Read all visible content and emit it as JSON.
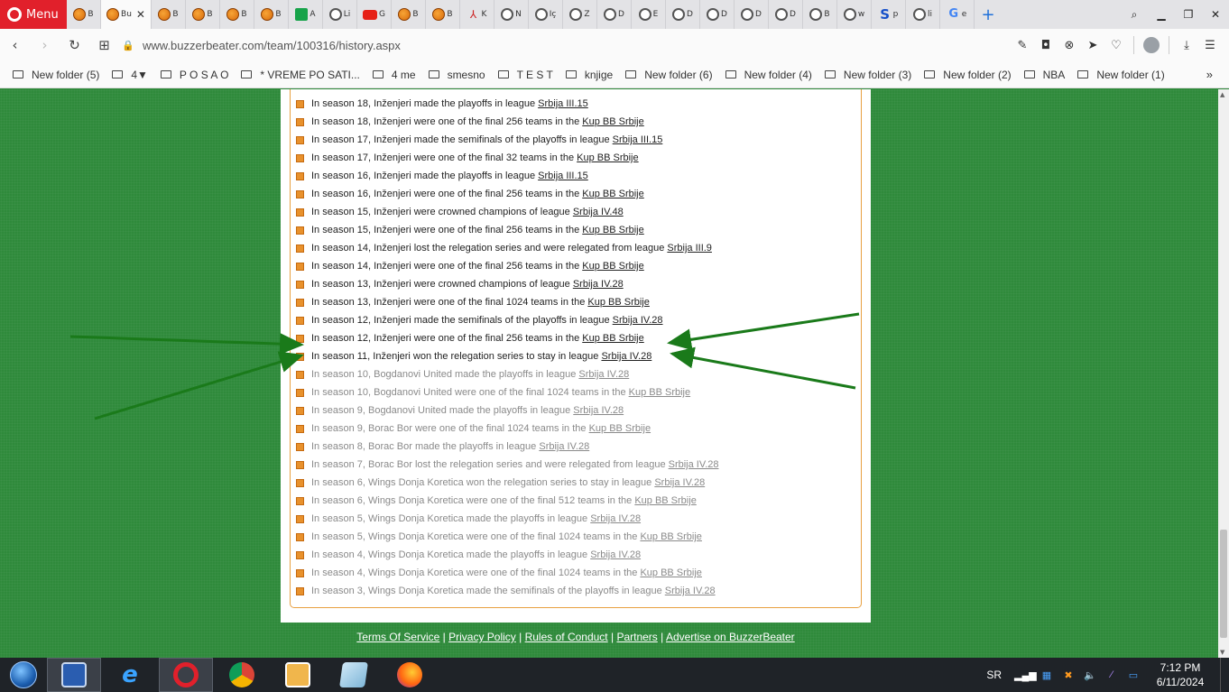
{
  "browser": {
    "menu_label": "Menu",
    "tabs": [
      {
        "label": "B",
        "icon": "ball"
      },
      {
        "label": "Bu",
        "icon": "ball",
        "active": true
      },
      {
        "label": "B",
        "icon": "ball"
      },
      {
        "label": "B",
        "icon": "ball"
      },
      {
        "label": "B",
        "icon": "ball"
      },
      {
        "label": "B",
        "icon": "ball"
      },
      {
        "label": "A",
        "icon": "green"
      },
      {
        "label": "Li",
        "icon": "gray"
      },
      {
        "label": "G",
        "icon": "yt"
      },
      {
        "label": "B",
        "icon": "ball"
      },
      {
        "label": "B",
        "icon": "ball"
      },
      {
        "label": "K",
        "icon": "red"
      },
      {
        "label": "N",
        "icon": "gray"
      },
      {
        "label": "Iç",
        "icon": "gray"
      },
      {
        "label": "Z",
        "icon": "gray"
      },
      {
        "label": "D",
        "icon": "gray"
      },
      {
        "label": "E",
        "icon": "gray"
      },
      {
        "label": "D",
        "icon": "gray"
      },
      {
        "label": "D",
        "icon": "gray"
      },
      {
        "label": "D",
        "icon": "gray"
      },
      {
        "label": "D",
        "icon": "gray"
      },
      {
        "label": "B",
        "icon": "gray"
      },
      {
        "label": "w",
        "icon": "gray"
      },
      {
        "label": "p",
        "icon": "s"
      },
      {
        "label": "li",
        "icon": "gray"
      },
      {
        "label": "e",
        "icon": "g"
      }
    ],
    "url": "www.buzzerbeater.com/team/100316/history.aspx",
    "bookmarks": [
      "New folder (5)",
      "4▼",
      "P O S A O",
      "* VREME PO SATI...",
      "4 me",
      "smesno",
      "T E S T",
      "knjige",
      "New folder (6)",
      "New folder (4)",
      "New folder (3)",
      "New folder (2)",
      "NBA",
      "New folder (1)"
    ]
  },
  "history": {
    "entries": [
      {
        "pre": "In season 18, Inženjeri made the playoffs in league ",
        "link": "Srbija III.15",
        "current": true
      },
      {
        "pre": "In season 18, Inženjeri were one of the final 256 teams in the ",
        "link": "Kup BB Srbije",
        "current": true
      },
      {
        "pre": "In season 17, Inženjeri made the semifinals of the playoffs in league ",
        "link": "Srbija III.15",
        "current": true
      },
      {
        "pre": "In season 17, Inženjeri were one of the final 32 teams in the ",
        "link": "Kup BB Srbije",
        "current": true
      },
      {
        "pre": "In season 16, Inženjeri made the playoffs in league ",
        "link": "Srbija III.15",
        "current": true
      },
      {
        "pre": "In season 16, Inženjeri were one of the final 256 teams in the ",
        "link": "Kup BB Srbije",
        "current": true
      },
      {
        "pre": "In season 15, Inženjeri were crowned champions of league ",
        "link": "Srbija IV.48",
        "current": true
      },
      {
        "pre": "In season 15, Inženjeri were one of the final 256 teams in the ",
        "link": "Kup BB Srbije",
        "current": true
      },
      {
        "pre": "In season 14, Inženjeri lost the relegation series and were relegated from league ",
        "link": "Srbija III.9",
        "current": true
      },
      {
        "pre": "In season 14, Inženjeri were one of the final 256 teams in the ",
        "link": "Kup BB Srbije",
        "current": true
      },
      {
        "pre": "In season 13, Inženjeri were crowned champions of league ",
        "link": "Srbija IV.28",
        "current": true
      },
      {
        "pre": "In season 13, Inženjeri were one of the final 1024 teams in the ",
        "link": "Kup BB Srbije",
        "current": true
      },
      {
        "pre": "In season 12, Inženjeri made the semifinals of the playoffs in league ",
        "link": "Srbija IV.28",
        "current": true
      },
      {
        "pre": "In season 12, Inženjeri were one of the final 256 teams in the ",
        "link": "Kup BB Srbije",
        "current": true
      },
      {
        "pre": "In season 11, Inženjeri won the relegation series to stay in league ",
        "link": "Srbija IV.28",
        "current": true
      },
      {
        "pre": "In season 10, Bogdanovi United made the playoffs in league ",
        "link": "Srbija IV.28",
        "current": false
      },
      {
        "pre": "In season 10, Bogdanovi United were one of the final 1024 teams in the ",
        "link": "Kup BB Srbije",
        "current": false
      },
      {
        "pre": "In season 9, Bogdanovi United made the playoffs in league ",
        "link": "Srbija IV.28",
        "current": false
      },
      {
        "pre": "In season 9, Borac Bor were one of the final 1024 teams in the ",
        "link": "Kup BB Srbije",
        "current": false
      },
      {
        "pre": "In season 8, Borac Bor made the playoffs in league ",
        "link": "Srbija IV.28",
        "current": false
      },
      {
        "pre": "In season 7, Borac Bor lost the relegation series and were relegated from league ",
        "link": "Srbija IV.28",
        "current": false
      },
      {
        "pre": "In season 6, Wings Donja Koretica won the relegation series to stay in league ",
        "link": "Srbija IV.28",
        "current": false
      },
      {
        "pre": "In season 6, Wings Donja Koretica were one of the final 512 teams in the ",
        "link": "Kup BB Srbije",
        "current": false
      },
      {
        "pre": "In season 5, Wings Donja Koretica made the playoffs in league ",
        "link": "Srbija IV.28",
        "current": false
      },
      {
        "pre": "In season 5, Wings Donja Koretica were one of the final 1024 teams in the ",
        "link": "Kup BB Srbije",
        "current": false
      },
      {
        "pre": "In season 4, Wings Donja Koretica made the playoffs in league ",
        "link": "Srbija IV.28",
        "current": false
      },
      {
        "pre": "In season 4, Wings Donja Koretica were one of the final 1024 teams in the ",
        "link": "Kup BB Srbije",
        "current": false
      },
      {
        "pre": "In season 3, Wings Donja Koretica made the semifinals of the playoffs in league ",
        "link": "Srbija IV.28",
        "current": false
      }
    ]
  },
  "footer": {
    "links": [
      "Terms Of Service",
      "Privacy Policy",
      "Rules of Conduct",
      "Partners",
      "Advertise on BuzzerBeater"
    ],
    "separator": " | "
  },
  "colors": {
    "page_bg": "#2f8a3b",
    "arrow": "#1a7a1a",
    "box_border": "#e8a040",
    "bullet": "#e8912c"
  },
  "taskbar": {
    "apps": [
      "save-app",
      "internet-explorer",
      "opera",
      "chrome",
      "media-player",
      "notepad",
      "firefox"
    ],
    "lang": "SR",
    "time": "7:12 PM",
    "date": "6/11/2024"
  }
}
